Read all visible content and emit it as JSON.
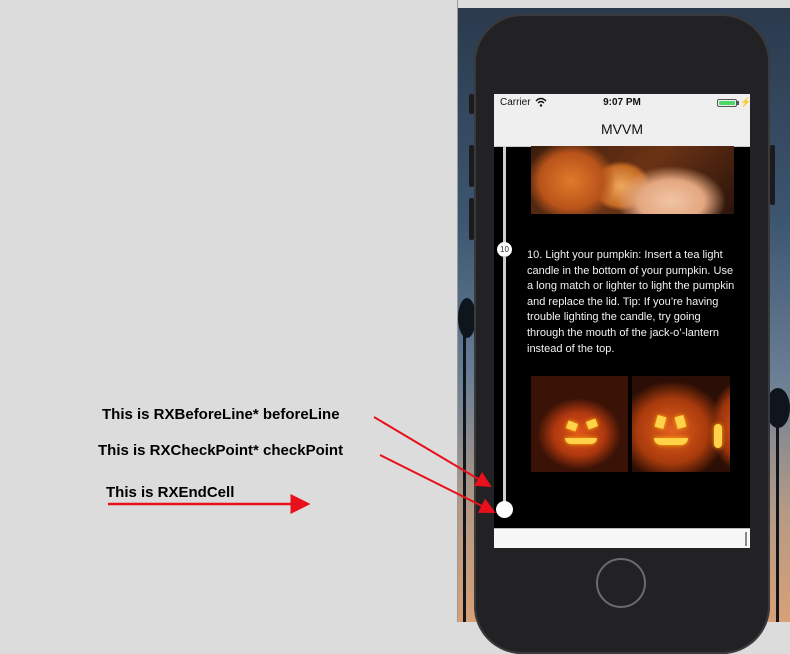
{
  "phone": {
    "status_bar": {
      "carrier": "Carrier",
      "time": "9:07 PM",
      "wifi_icon": "wifi-icon",
      "battery_icon": "battery-icon",
      "bolt_icon": "charging-bolt-icon"
    },
    "nav_bar": {
      "title": "MVVM"
    },
    "timeline": {
      "step_number": "10",
      "step_text": "10. Light your pumpkin: Insert a tea light candle in the bottom of your pumpkin. Use a long match or lighter to light the pumpkin and replace the lid. Tip: If you’re having trouble lighting the candle, try going through the mouth of the jack-o’-lantern instead of the top."
    }
  },
  "annotations": {
    "before_line": "This is RXBeforeLine* beforeLine",
    "check_point": "This is RXCheckPoint* checkPoint",
    "end_cell": "This is RXEndCell"
  },
  "colors": {
    "arrow": "#e8101a",
    "battery": "#4cd964",
    "background": "#dcdcdc"
  }
}
